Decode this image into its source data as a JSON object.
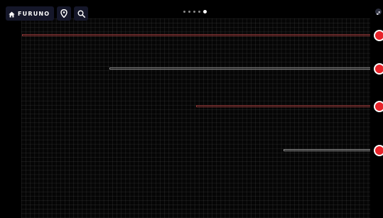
{
  "header": {
    "brand_label": "FURUNO",
    "home_icon": "home-icon",
    "location_icon": "location-pin-icon",
    "search_icon": "search-icon"
  },
  "pager": {
    "page_count": 5,
    "active_page": 5
  },
  "corner_icon": "expand-icon",
  "tracks": [
    {
      "name": "track-1",
      "start_fraction": 0.0,
      "color": "#8a3535",
      "knob_color": "#e8232a"
    },
    {
      "name": "track-2",
      "start_fraction": 0.25,
      "color": "#8a8a8a",
      "knob_color": "#e8232a"
    },
    {
      "name": "track-3",
      "start_fraction": 0.5,
      "color": "#8a3535",
      "knob_color": "#e8232a"
    },
    {
      "name": "track-4",
      "start_fraction": 0.75,
      "color": "#8a8a8a",
      "knob_color": "#e8232a"
    }
  ],
  "colors": {
    "background": "#000000",
    "toolbar": "#15172a",
    "knob": "#e8232a",
    "grid_line": "#ffffff12"
  }
}
